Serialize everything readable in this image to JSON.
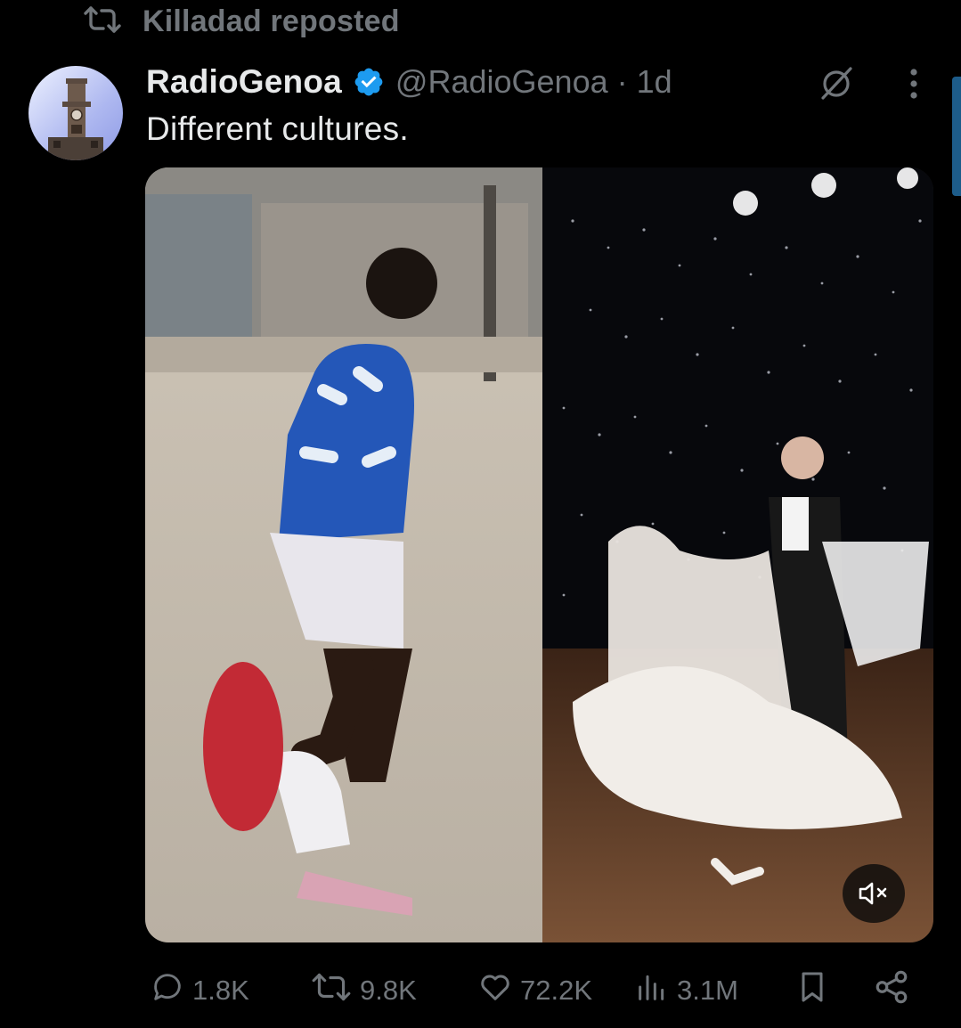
{
  "repost": {
    "icon": "repost-icon",
    "label": "Killadad reposted"
  },
  "tweet": {
    "author_name": "RadioGenoa",
    "verified": true,
    "handle": "@RadioGenoa",
    "separator": "·",
    "time": "1d",
    "text": "Different cultures.",
    "media": {
      "type": "video",
      "muted": true,
      "mute_icon": "volume-muted-icon"
    }
  },
  "actions": {
    "replies": "1.8K",
    "reposts": "9.8K",
    "likes": "72.2K",
    "views": "3.1M"
  },
  "colors": {
    "background": "#000000",
    "primary_text": "#e7e9ea",
    "secondary_text": "#71767b",
    "verified_blue": "#1d9bf0"
  }
}
